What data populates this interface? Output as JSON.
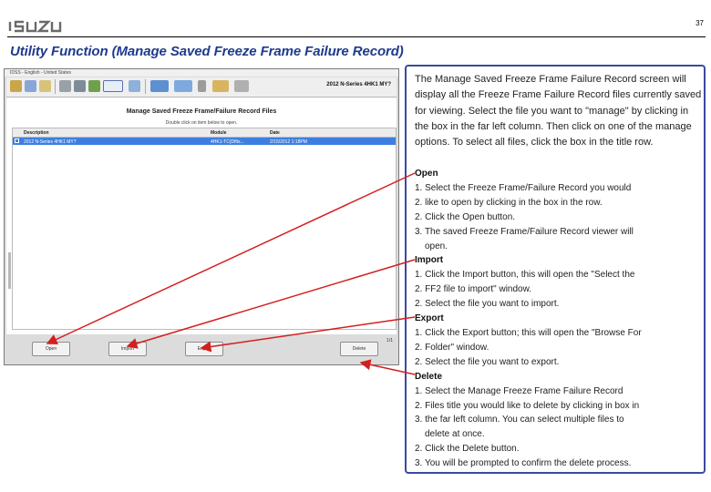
{
  "header": {
    "logo_text": "ISUZU",
    "page_number": "37",
    "title": "Utility Function (Manage Saved Freeze Frame Failure Record)"
  },
  "screenshot": {
    "window_title": "IDSS - English - United States",
    "vehicle": "2012 N-Series 4HK1 MY?",
    "heading": "Manage Saved Freeze Frame/Failure Record Files",
    "subheading": "Double click on item below to open.",
    "columns": [
      "Description",
      "Module",
      "Date"
    ],
    "rows": [
      {
        "description": "2012 N-Series 4HK1 MY?",
        "module": "4HK1-TC(Dflts...",
        "date": "2/15/2012 1:18PM"
      }
    ],
    "item_count": "1/1",
    "buttons": {
      "open": "Open",
      "import": "Import",
      "export": "Export",
      "delete": "Delete"
    }
  },
  "panel": {
    "intro": "The Manage Saved Freeze Frame Failure Record screen will display all the Freeze Frame Failure Record files currently saved for viewing.  Select the file you want to \"manage\" by clicking in the box in the far left column.  Then click on one of the manage options.  To select all files, click the box in the title row.",
    "lines": [
      {
        "text": "Open",
        "style": "h"
      },
      {
        "text": "1. Select the Freeze Frame/Failure Record you would",
        "style": ""
      },
      {
        "text": "2.   like to open by clicking in the box in the row.",
        "style": ""
      },
      {
        "text": "2. Click the Open button.",
        "style": ""
      },
      {
        "text": "3. The saved Freeze Frame/Failure Record viewer will",
        "style": ""
      },
      {
        "text": "open.",
        "style": "ind"
      },
      {
        "text": "Import",
        "style": "h"
      },
      {
        "text": "1. Click the Import button, this will open the \"Select the",
        "style": ""
      },
      {
        "text": "2.   FF2 file to import\" window.",
        "style": ""
      },
      {
        "text": "2. Select the file you want to import.",
        "style": ""
      },
      {
        "text": "Export",
        "style": "h"
      },
      {
        "text": "1. Click the Export button; this will open the \"Browse For",
        "style": ""
      },
      {
        "text": "2.   Folder\" window.",
        "style": ""
      },
      {
        "text": "2. Select the file you want to export.",
        "style": ""
      },
      {
        "text": "Delete",
        "style": "h"
      },
      {
        "text": "1. Select the Manage Freeze Frame Failure Record",
        "style": ""
      },
      {
        "text": "2.   Files title you would like to delete by clicking in box in",
        "style": ""
      },
      {
        "text": "3.   the far left column.  You can select multiple files to",
        "style": ""
      },
      {
        "text": "delete at once.",
        "style": "ind"
      },
      {
        "text": "2. Click the Delete button.",
        "style": ""
      },
      {
        "text": "3. You will be prompted to confirm the delete process.",
        "style": ""
      }
    ]
  },
  "colors": {
    "title": "#1f3a8c",
    "panel_border": "#3b4aa0",
    "arrow": "#d41f1f",
    "row_selected": "#3d7fe0"
  }
}
